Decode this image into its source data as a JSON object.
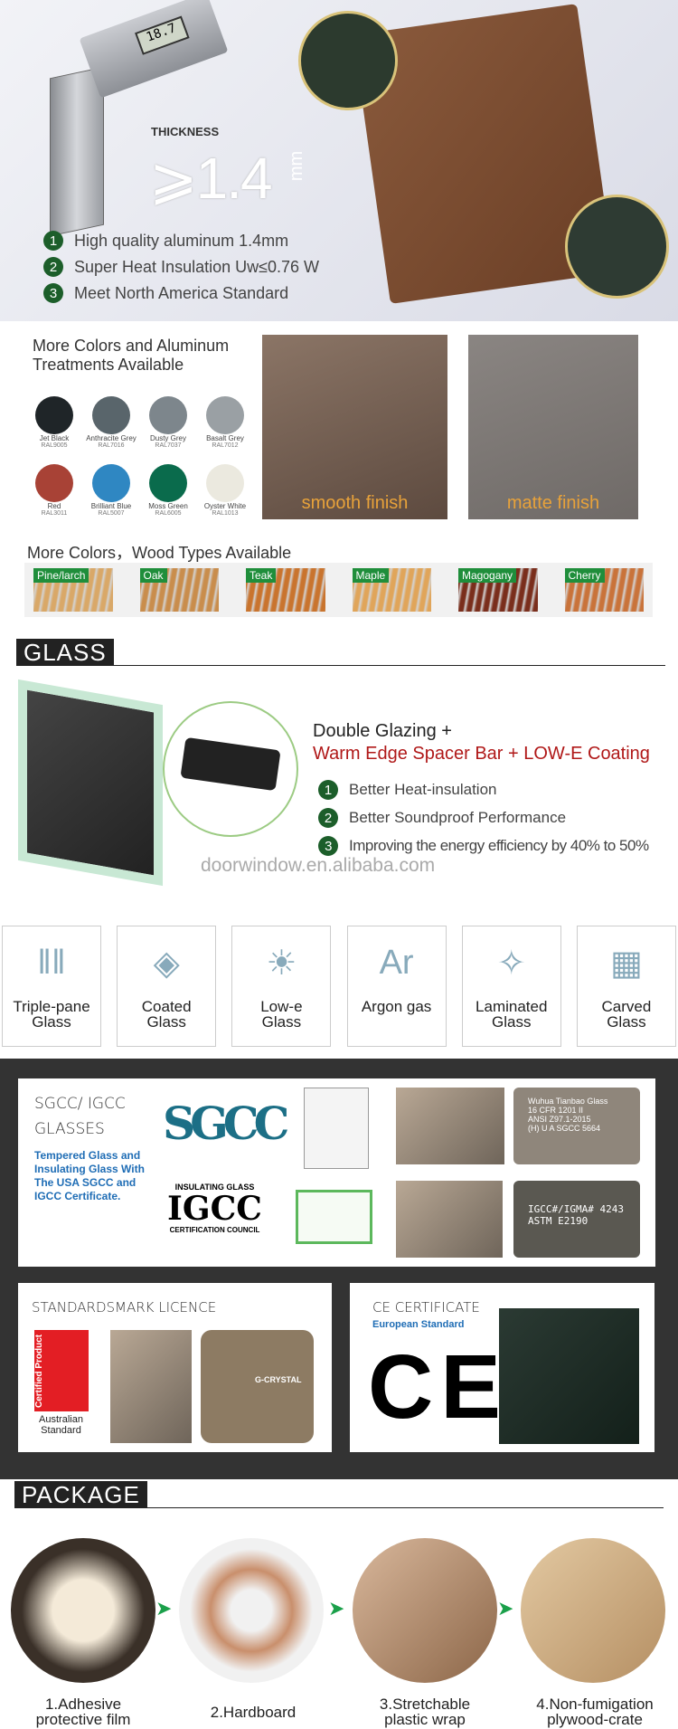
{
  "hero": {
    "caliper_reading": "18.7",
    "thickness_label": "THICKNESS",
    "thickness_value": "⩾1.4",
    "thickness_unit": "mm",
    "features": [
      {
        "num": "1",
        "text": "High quality aluminum 1.4mm"
      },
      {
        "num": "2",
        "text": "Super Heat Insulation Uw≤0.76 W"
      },
      {
        "num": "3",
        "text": "Meet North America Standard"
      }
    ]
  },
  "colors": {
    "title_line1": "More Colors and Aluminum",
    "title_line2": "Treatments Available",
    "swatches": [
      {
        "name": "Jet Black",
        "code": "RAL9005",
        "color": "#1f2528"
      },
      {
        "name": "Anthracite Grey",
        "code": "RAL7016",
        "color": "#59656b"
      },
      {
        "name": "Dusty Grey",
        "code": "RAL7037",
        "color": "#7d868c"
      },
      {
        "name": "Basalt Grey",
        "code": "RAL7012",
        "color": "#9aa0a4"
      },
      {
        "name": "Red",
        "code": "RAL3011",
        "color": "#a84236"
      },
      {
        "name": "Brilliant Blue",
        "code": "RAL5007",
        "color": "#2f87c2"
      },
      {
        "name": "Moss Green",
        "code": "RAL6005",
        "color": "#0a6b4c"
      },
      {
        "name": "Oyster White",
        "code": "RAL1013",
        "color": "#ebe9df"
      }
    ],
    "finishes": [
      "smooth finish",
      "matte finish"
    ]
  },
  "wood": {
    "title": "More Colors，Wood Types Available",
    "types": [
      {
        "name": "Pine/larch",
        "color": "#d9a868"
      },
      {
        "name": "Oak",
        "color": "#c98d4c"
      },
      {
        "name": "Teak",
        "color": "#c9742e"
      },
      {
        "name": "Maple",
        "color": "#e0a55a"
      },
      {
        "name": "Magogany",
        "color": "#7a2e1c"
      },
      {
        "name": "Cherry",
        "color": "#c9733a"
      }
    ]
  },
  "glass": {
    "header": "GLASS",
    "line1": "Double Glazing +",
    "line2": "Warm Edge Spacer Bar + LOW-E Coating",
    "features": [
      {
        "num": "1",
        "text": "Better Heat-insulation"
      },
      {
        "num": "2",
        "text": "Better Soundproof Performance"
      },
      {
        "num": "3",
        "text": "Improving the energy efficiency by 40% to 50%"
      }
    ],
    "watermark": "doorwindow.en.alibaba.com",
    "types": [
      {
        "l1": "Triple-pane",
        "l2": "Glass",
        "icon": "‖‖"
      },
      {
        "l1": "Coated",
        "l2": "Glass",
        "icon": "◈"
      },
      {
        "l1": "Low-e",
        "l2": "Glass",
        "icon": "☀"
      },
      {
        "l1": "Argon gas",
        "l2": "",
        "icon": "Ar"
      },
      {
        "l1": "Laminated",
        "l2": "Glass",
        "icon": "✧"
      },
      {
        "l1": "Carved",
        "l2": "Glass",
        "icon": "▦"
      }
    ]
  },
  "certs": {
    "sgcc_title1": "SGCC/ IGCC",
    "sgcc_title2": "GLASSES",
    "sgcc_desc": "Tempered Glass and Insulating Glass With The USA SGCC and IGCC Certificate.",
    "sgcc_logo": "SGCC",
    "igcc_top": "INSULATING GLASS",
    "igcc_logo": "IGCC",
    "igcc_bottom": "CERTIFICATION COUNCIL",
    "stamp1": [
      "Wuhua Tianbao Glass",
      "16 CFR 1201 II",
      "ANSI Z97.1-2015",
      "(H) U A SGCC 5664"
    ],
    "stamp2": [
      "IGCC#/IGMA# 4243",
      "ASTM E2190"
    ],
    "std_title": "STANDARDSMARK LICENCE",
    "certified": "Certified Product",
    "aus1": "Australian",
    "aus2": "Standard",
    "gcrystal": "G-CRYSTAL",
    "ce_title": "CE CERTIFICATE",
    "ce_sub": "European Standard",
    "ce_logo": "CE"
  },
  "package": {
    "header": "PACKAGE",
    "steps": [
      {
        "l1": "1.Adhesive",
        "l2": "protective film"
      },
      {
        "l1": "2.Hardboard",
        "l2": ""
      },
      {
        "l1": "3.Stretchable",
        "l2": "plastic wrap"
      },
      {
        "l1": "4.Non-fumigation",
        "l2": "plywood-crate"
      }
    ]
  }
}
